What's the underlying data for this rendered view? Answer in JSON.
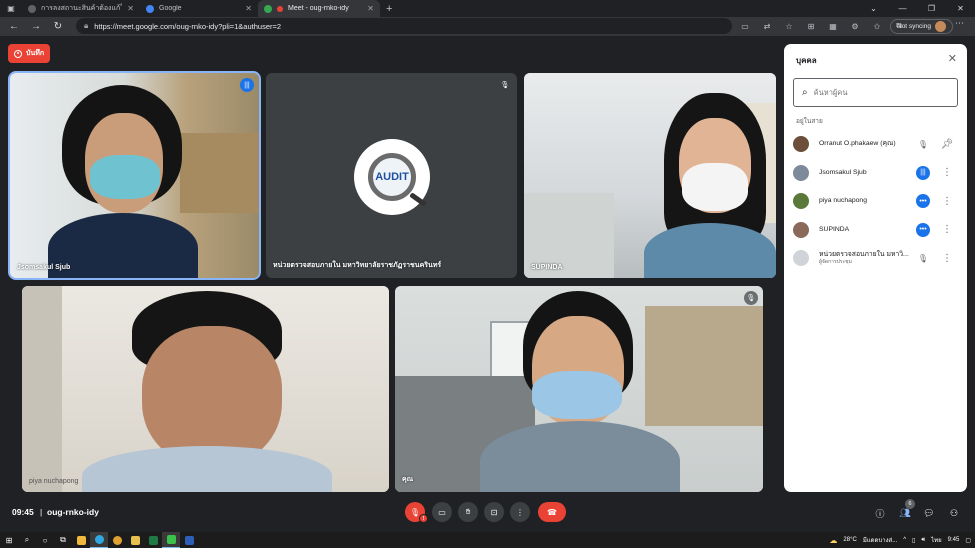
{
  "browser": {
    "tabs": [
      {
        "title": "การลงสถานะสินค้าต้องแก้ใน",
        "active": false
      },
      {
        "title": "Google",
        "active": false
      },
      {
        "title": "Meet - oug-rnko-idy",
        "active": true
      }
    ],
    "url": "https://meet.google.com/oug-rnko-idy?pli=1&authuser=2",
    "sync_label": "Not syncing",
    "new_tab": "+",
    "close": "✕"
  },
  "meeting": {
    "record_label": "บันทึก",
    "time": "09:45",
    "separator": "|",
    "code": "oug-rnko-idy",
    "participant_count": "6",
    "tiles": [
      {
        "name": "Jsomsakul Sjub",
        "mic": "speaking"
      },
      {
        "name": "หน่วยตรวจสอบภายใน มหาวิทยาลัยราชภัฏราชนครินทร์",
        "mic": "muted",
        "avatar": "AUDIT"
      },
      {
        "name": "SUPINDA",
        "mic": "none"
      },
      {
        "name": "piya nuchapong",
        "mic": "none"
      },
      {
        "name": "คุณ",
        "mic": "muted"
      }
    ]
  },
  "panel": {
    "title": "บุคคล",
    "search_placeholder": "ค้นหาผู้คน",
    "section": "อยู่ในสาย",
    "people": [
      {
        "name": "Orranut O.phakaew (คุณ)",
        "sub": "",
        "status": "muted",
        "action": "pin",
        "avatar_color": "#6b4f3a"
      },
      {
        "name": "Jsomsakul Sjub",
        "sub": "",
        "status": "speaking",
        "action": "more",
        "avatar_color": "#7d8a9a"
      },
      {
        "name": "piya nuchapong",
        "sub": "",
        "status": "dots",
        "action": "more",
        "avatar_color": "#5b7a3a"
      },
      {
        "name": "SUPINDA",
        "sub": "",
        "status": "dots",
        "action": "more",
        "avatar_color": "#8a6a5a"
      },
      {
        "name": "หน่วยตรวจสอบภายใน มหาวิ...",
        "sub": "ผู้จัดการประชุม",
        "status": "muted",
        "action": "more",
        "avatar_color": "#d0d4d8"
      }
    ]
  },
  "taskbar": {
    "temperature": "28°C",
    "weather": "มีแดดบางส่...",
    "lang": "ไทย",
    "clock": "9:45"
  },
  "colors": {
    "accent": "#1a73e8",
    "danger": "#ea4335",
    "background": "#202124",
    "tile": "#3c4043"
  }
}
